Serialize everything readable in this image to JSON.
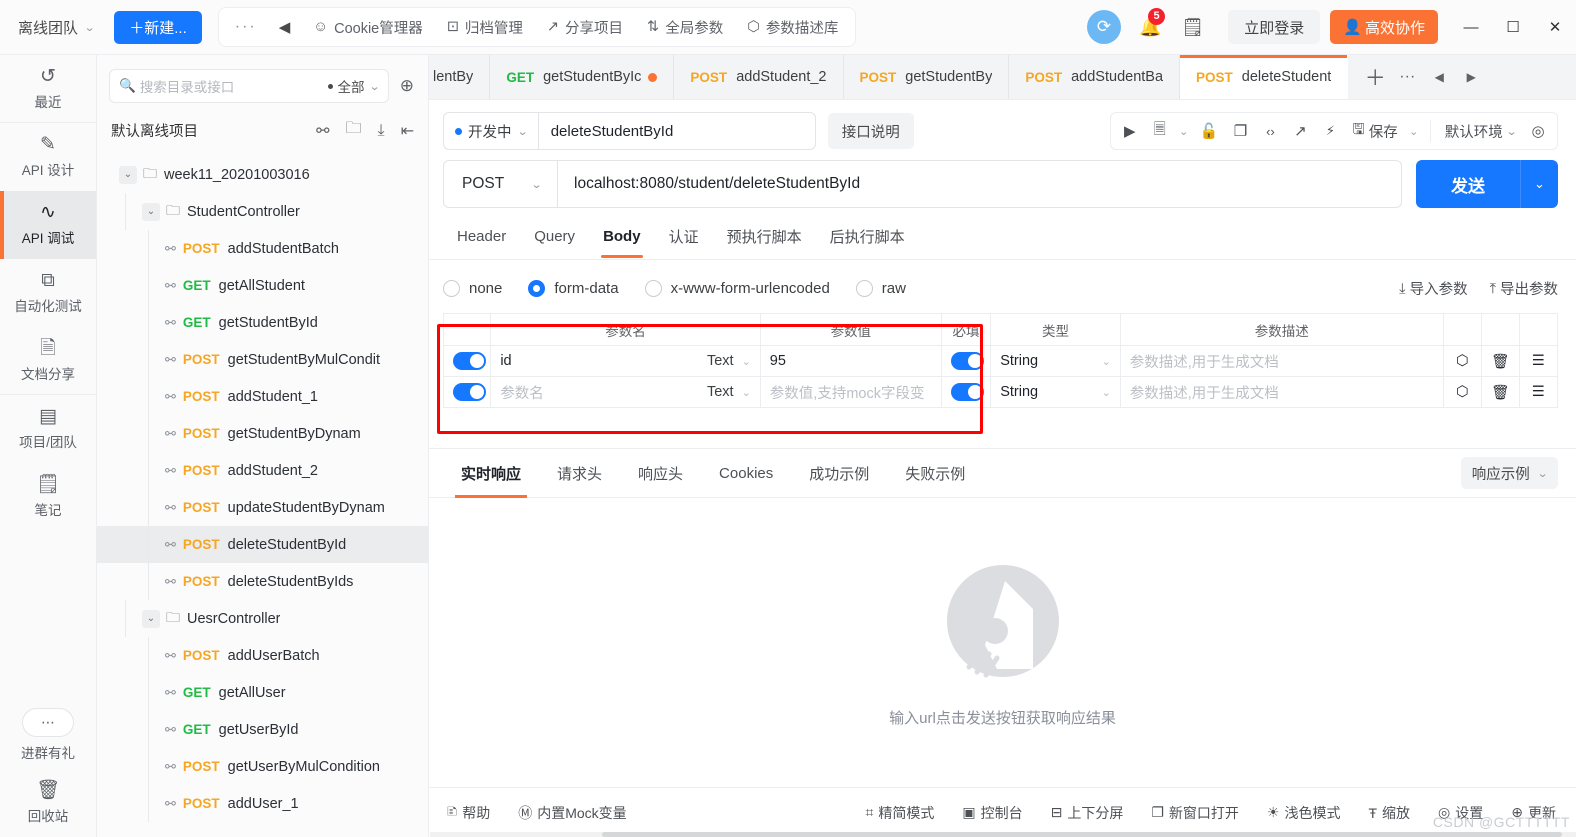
{
  "titlebar": {
    "team": "离线团队",
    "new_button": "＋新建...",
    "more": "···",
    "back": "◀",
    "menu": [
      {
        "label": "Cookie管理器",
        "icon": "cookie-icon",
        "glyph": "☺"
      },
      {
        "label": "归档管理",
        "icon": "archive-icon",
        "glyph": "⊡"
      },
      {
        "label": "分享项目",
        "icon": "share-icon",
        "glyph": "↗"
      },
      {
        "label": "全局参数",
        "icon": "global-params-icon",
        "glyph": "⇅"
      },
      {
        "label": "参数描述库",
        "icon": "param-lib-icon",
        "glyph": "⬡"
      }
    ],
    "sync_icon": "sync-icon",
    "notification_count": "5",
    "note_icon": "note-icon",
    "login": "立即登录",
    "collab": "高效协作",
    "minimize": "—",
    "maximize": "☐",
    "close": "✕"
  },
  "rail": [
    {
      "label": "最近",
      "icon": "history-icon",
      "glyph": "↺",
      "active": false
    },
    {
      "label": "API 设计",
      "icon": "design-icon",
      "glyph": "✎",
      "active": false
    },
    {
      "label": "API 调试",
      "icon": "debug-icon",
      "glyph": "∿",
      "active": true
    },
    {
      "label": "自动化测试",
      "icon": "automation-icon",
      "glyph": "⧉",
      "active": false
    },
    {
      "label": "文档分享",
      "icon": "doc-share-icon",
      "glyph": "🗎",
      "active": false
    },
    {
      "label": "项目/团队",
      "icon": "project-team-icon",
      "glyph": "▤",
      "active": false
    },
    {
      "label": "笔记",
      "icon": "notes-icon",
      "glyph": "🗒",
      "active": false
    }
  ],
  "rail_bottom": [
    {
      "label": "进群有礼",
      "icon": "group-gift-icon",
      "glyph": "⋯"
    },
    {
      "label": "回收站",
      "icon": "trash-icon",
      "glyph": "🗑"
    }
  ],
  "directory": {
    "search_placeholder": "搜索目录或接口",
    "search_icon": "search-icon",
    "scope": "全部",
    "locate_icon": "locate-icon",
    "project_name": "默认离线项目",
    "actions": [
      {
        "icon": "add-api-icon",
        "glyph": "⚯"
      },
      {
        "icon": "add-folder-icon",
        "glyph": "🗀"
      },
      {
        "icon": "import-icon",
        "glyph": "⤓"
      },
      {
        "icon": "collapse-all-icon",
        "glyph": "⇤"
      }
    ],
    "tree": [
      {
        "type": "folder",
        "label": "week11_20201003016",
        "depth": 0,
        "expanded": true
      },
      {
        "type": "folder",
        "label": "StudentController",
        "depth": 1,
        "expanded": true
      },
      {
        "type": "api",
        "method": "POST",
        "label": "addStudentBatch",
        "depth": 2
      },
      {
        "type": "api",
        "method": "GET",
        "label": "getAllStudent",
        "depth": 2
      },
      {
        "type": "api",
        "method": "GET",
        "label": "getStudentById",
        "depth": 2
      },
      {
        "type": "api",
        "method": "POST",
        "label": "getStudentByMulCondit",
        "depth": 2
      },
      {
        "type": "api",
        "method": "POST",
        "label": "addStudent_1",
        "depth": 2
      },
      {
        "type": "api",
        "method": "POST",
        "label": "getStudentByDynam",
        "depth": 2
      },
      {
        "type": "api",
        "method": "POST",
        "label": "addStudent_2",
        "depth": 2
      },
      {
        "type": "api",
        "method": "POST",
        "label": "updateStudentByDynam",
        "depth": 2
      },
      {
        "type": "api",
        "method": "POST",
        "label": "deleteStudentById",
        "depth": 2,
        "selected": true
      },
      {
        "type": "api",
        "method": "POST",
        "label": "deleteStudentByIds",
        "depth": 2
      },
      {
        "type": "folder",
        "label": "UesrController",
        "depth": 1,
        "expanded": true
      },
      {
        "type": "api",
        "method": "POST",
        "label": "addUserBatch",
        "depth": 2
      },
      {
        "type": "api",
        "method": "GET",
        "label": "getAllUser",
        "depth": 2
      },
      {
        "type": "api",
        "method": "GET",
        "label": "getUserById",
        "depth": 2
      },
      {
        "type": "api",
        "method": "POST",
        "label": "getUserByMulCondition",
        "depth": 2
      },
      {
        "type": "api",
        "method": "POST",
        "label": "addUser_1",
        "depth": 2
      }
    ]
  },
  "tabs": [
    {
      "method": "",
      "label": "lentBy",
      "active": false,
      "dirty": false
    },
    {
      "method": "GET",
      "label": "getStudentByIc",
      "active": false,
      "dirty": true
    },
    {
      "method": "POST",
      "label": "addStudent_2",
      "active": false,
      "dirty": false
    },
    {
      "method": "POST",
      "label": "getStudentBy",
      "active": false,
      "dirty": false
    },
    {
      "method": "POST",
      "label": "addStudentBa",
      "active": false,
      "dirty": false
    },
    {
      "method": "POST",
      "label": "deleteStudent",
      "active": true,
      "dirty": false
    }
  ],
  "tab_actions": [
    {
      "icon": "add-tab-icon",
      "glyph": "＋"
    },
    {
      "icon": "more-tabs-icon",
      "glyph": "···"
    },
    {
      "icon": "tab-prev-icon",
      "glyph": "◀"
    },
    {
      "icon": "tab-next-icon",
      "glyph": "▶"
    }
  ],
  "request": {
    "status": "开发中",
    "name": "deleteStudentById",
    "desc_button": "接口说明",
    "toolbar": [
      {
        "icon": "run-icon",
        "glyph": "▶"
      },
      {
        "icon": "doc-icon",
        "glyph": "🗏"
      },
      {
        "icon": "doc-caret-icon",
        "glyph": "⌄"
      },
      {
        "icon": "unlock-icon",
        "glyph": "🔓"
      },
      {
        "icon": "copy-icon",
        "glyph": "❐"
      },
      {
        "icon": "code-icon",
        "glyph": "‹›"
      },
      {
        "icon": "export-icon",
        "glyph": "↗"
      },
      {
        "icon": "mock-icon",
        "glyph": "⚡"
      }
    ],
    "save_label": "保存",
    "save_icon": "save-icon",
    "save_caret": "⌄",
    "env": "默认环境",
    "eye_icon": "eye-icon",
    "method": "POST",
    "url": "localhost:8080/student/deleteStudentById",
    "send_label": "发送",
    "send_caret": "⌄",
    "subtabs": [
      {
        "label": "Header",
        "active": false
      },
      {
        "label": "Query",
        "active": false
      },
      {
        "label": "Body",
        "active": true
      },
      {
        "label": "认证",
        "active": false
      },
      {
        "label": "预执行脚本",
        "active": false
      },
      {
        "label": "后执行脚本",
        "active": false
      }
    ],
    "body_types": [
      {
        "label": "none",
        "selected": false
      },
      {
        "label": "form-data",
        "selected": true
      },
      {
        "label": "x-www-form-urlencoded",
        "selected": false
      },
      {
        "label": "raw",
        "selected": false
      }
    ],
    "import_params": "导入参数",
    "export_params": "导出参数",
    "param_table": {
      "headers": [
        "",
        "参数名",
        "参数值",
        "必填",
        "类型",
        "参数描述",
        "",
        "",
        ""
      ],
      "rows": [
        {
          "enabled": true,
          "name": "id",
          "name_placeholder": "",
          "value_type": "Text",
          "value": "95",
          "value_placeholder": "",
          "required": true,
          "type": "String",
          "description": "",
          "description_placeholder": "参数描述,用于生成文档"
        },
        {
          "enabled": true,
          "name": "",
          "name_placeholder": "参数名",
          "value_type": "Text",
          "value": "",
          "value_placeholder": "参数值,支持mock字段变",
          "required": true,
          "type": "String",
          "description": "",
          "description_placeholder": "参数描述,用于生成文档"
        }
      ],
      "row_icons": [
        {
          "icon": "mock-cube-icon",
          "glyph": "⬡"
        },
        {
          "icon": "delete-row-icon",
          "glyph": "🗑"
        },
        {
          "icon": "drag-row-icon",
          "glyph": "☰"
        }
      ]
    }
  },
  "response": {
    "tabs": [
      {
        "label": "实时响应",
        "active": true
      },
      {
        "label": "请求头",
        "active": false
      },
      {
        "label": "响应头",
        "active": false
      },
      {
        "label": "Cookies",
        "active": false
      },
      {
        "label": "成功示例",
        "active": false
      },
      {
        "label": "失败示例",
        "active": false
      }
    ],
    "example_select": "响应示例",
    "empty_text": "输入url点击发送按钮获取响应结果",
    "empty_icon": "rocket-placeholder-icon"
  },
  "footer": [
    {
      "label": "帮助",
      "icon": "help-icon",
      "glyph": "🗈"
    },
    {
      "label": "内置Mock变量",
      "icon": "mock-var-icon",
      "glyph": "Ⓜ"
    },
    {
      "label": "精简模式",
      "icon": "compact-mode-icon",
      "glyph": "⌗"
    },
    {
      "label": "控制台",
      "icon": "console-icon",
      "glyph": "▣"
    },
    {
      "label": "上下分屏",
      "icon": "split-screen-icon",
      "glyph": "⊟"
    },
    {
      "label": "新窗口打开",
      "icon": "new-window-icon",
      "glyph": "❐"
    },
    {
      "label": "浅色模式",
      "icon": "light-mode-icon",
      "glyph": "☀"
    },
    {
      "label": "缩放",
      "icon": "zoom-icon",
      "glyph": "Ŧ"
    },
    {
      "label": "设置",
      "icon": "settings-icon",
      "glyph": "◎"
    },
    {
      "label": "更新",
      "icon": "update-icon",
      "glyph": "⊕"
    }
  ],
  "watermark": "CSDN @GCTTTTTT",
  "colors": {
    "accent_blue": "#1677ff",
    "accent_orange": "#fb7235",
    "method_post": "#f5a623",
    "method_get": "#21ba45",
    "highlight_red": "#ff0000",
    "badge_red": "#f5222d"
  }
}
